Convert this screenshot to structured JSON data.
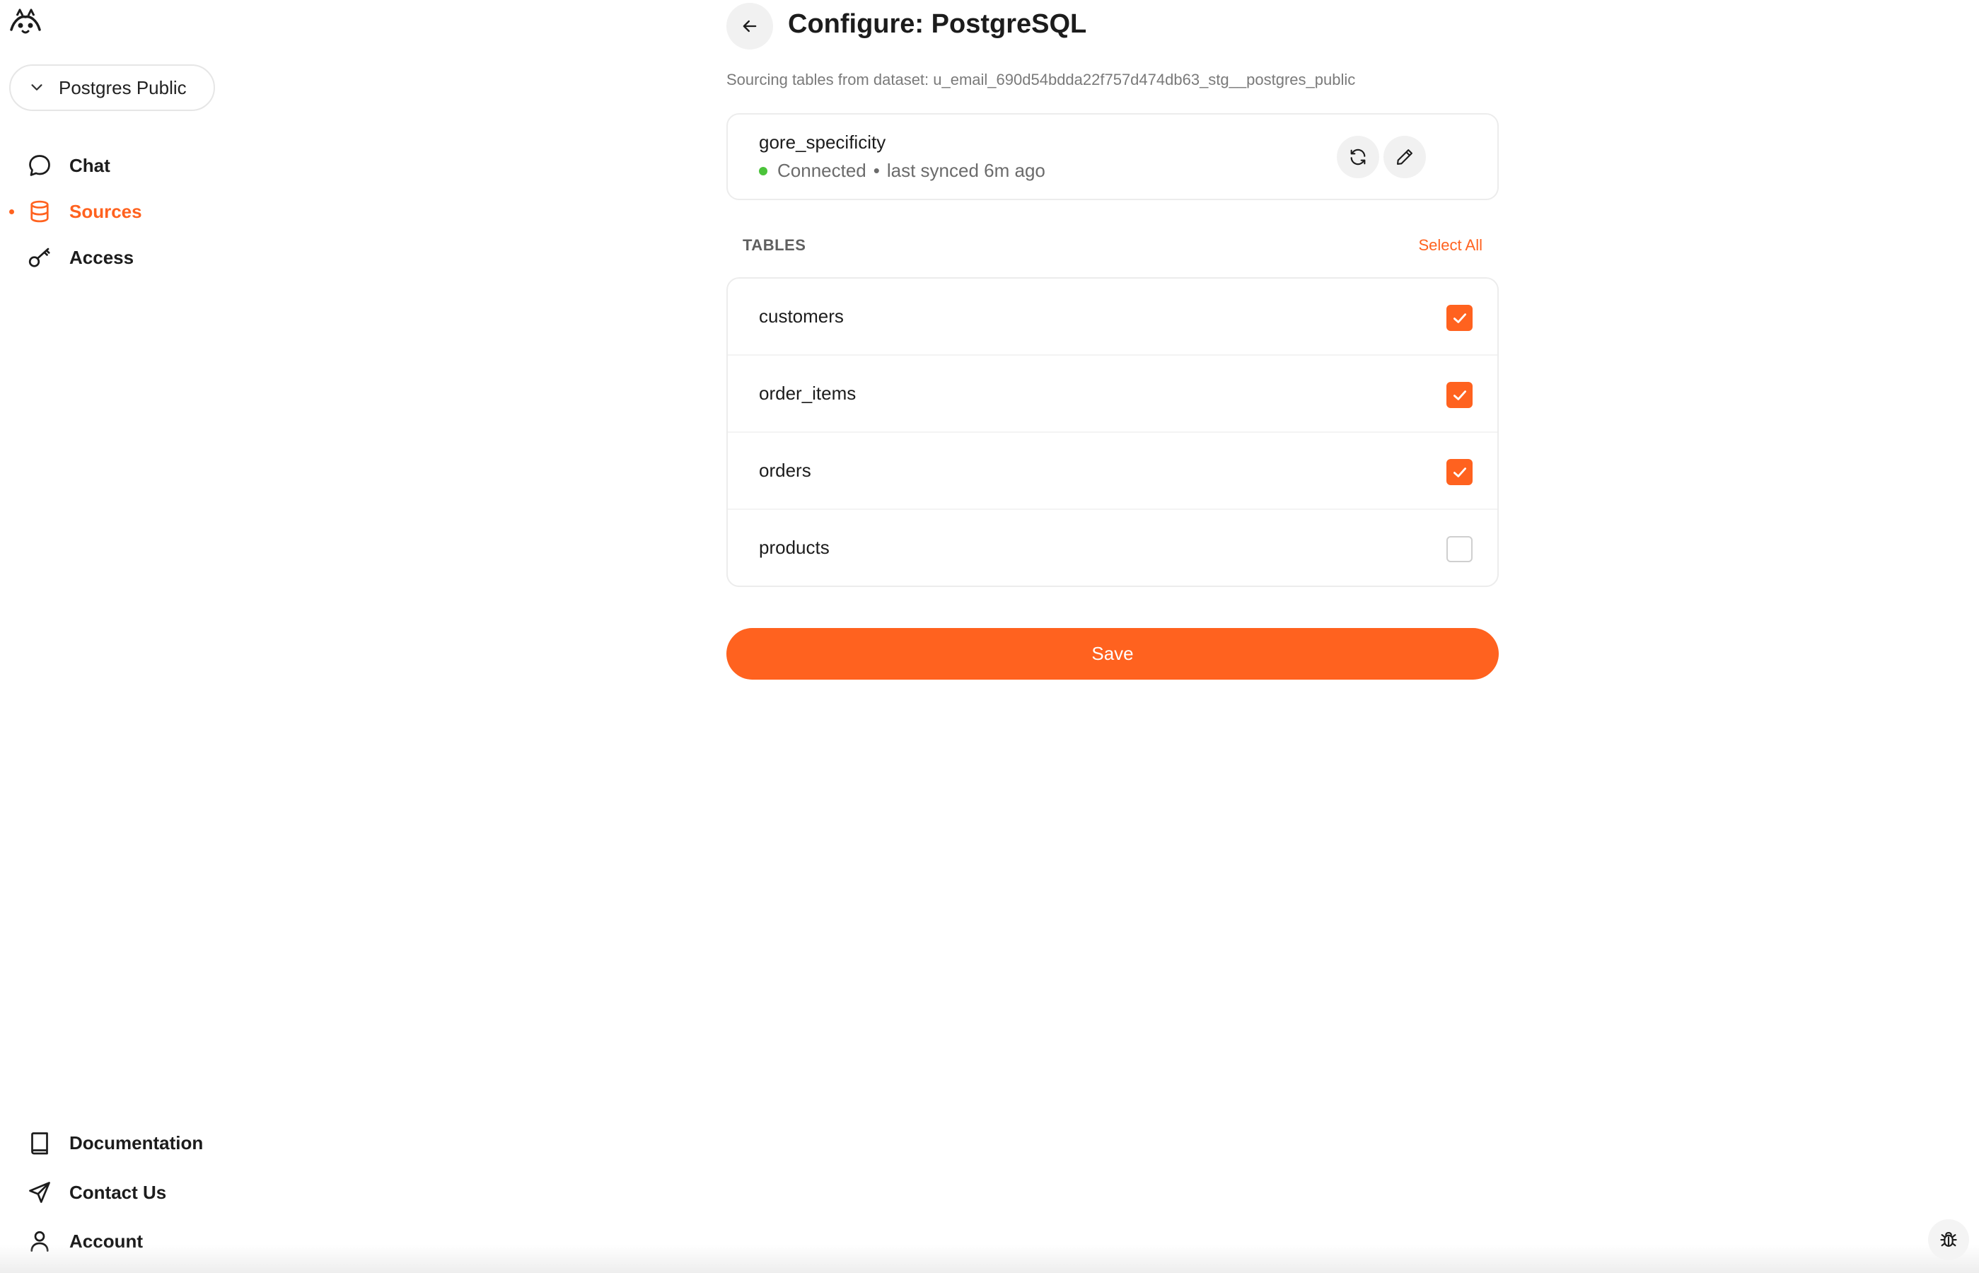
{
  "sidebar": {
    "workspace": "Postgres Public",
    "nav": [
      {
        "label": "Chat",
        "icon": "chat-bubble-icon",
        "active": false
      },
      {
        "label": "Sources",
        "icon": "database-icon",
        "active": true
      },
      {
        "label": "Access",
        "icon": "key-icon",
        "active": false
      }
    ],
    "footer": [
      {
        "label": "Documentation",
        "icon": "book-icon"
      },
      {
        "label": "Contact Us",
        "icon": "send-icon"
      },
      {
        "label": "Account",
        "icon": "user-icon"
      }
    ]
  },
  "main": {
    "title": "Configure: PostgreSQL",
    "dataset_line": "Sourcing tables from dataset: u_email_690d54bdda22f757d474db63_stg__postgres_public",
    "source": {
      "name": "gore_specificity",
      "status": "Connected",
      "separator": "•",
      "sync": "last synced 6m ago",
      "status_color": "#4bc33a"
    },
    "tables_header": "TABLES",
    "select_all": "Select All",
    "tables": [
      {
        "name": "customers",
        "checked": true
      },
      {
        "name": "order_items",
        "checked": true
      },
      {
        "name": "orders",
        "checked": true
      },
      {
        "name": "products",
        "checked": false
      }
    ],
    "save_label": "Save"
  },
  "colors": {
    "accent": "#ff621f",
    "text": "#1c1c1c",
    "muted": "#7a7a7a"
  }
}
